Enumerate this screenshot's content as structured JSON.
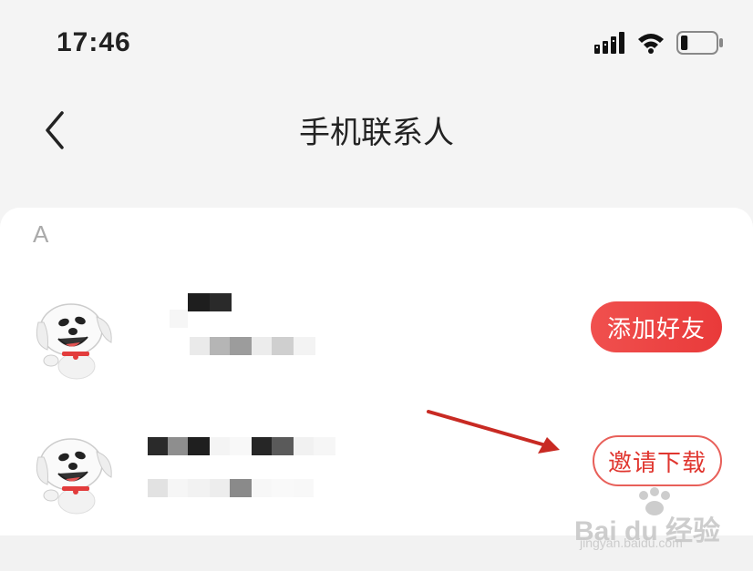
{
  "status_bar": {
    "time": "17:46",
    "battery_level": 0.2
  },
  "nav": {
    "title": "手机联系人"
  },
  "section": {
    "letter": "A"
  },
  "contacts": [
    {
      "button_label": "添加好友"
    },
    {
      "button_label": "邀请下载"
    }
  ],
  "watermark": {
    "brand": "Bai du 经验",
    "url": "jingyan.baidu.com"
  },
  "colors": {
    "accent": "#e93a3a",
    "outline": "#e8605a",
    "arrow": "#c82a23",
    "background": "#f4f4f4"
  }
}
